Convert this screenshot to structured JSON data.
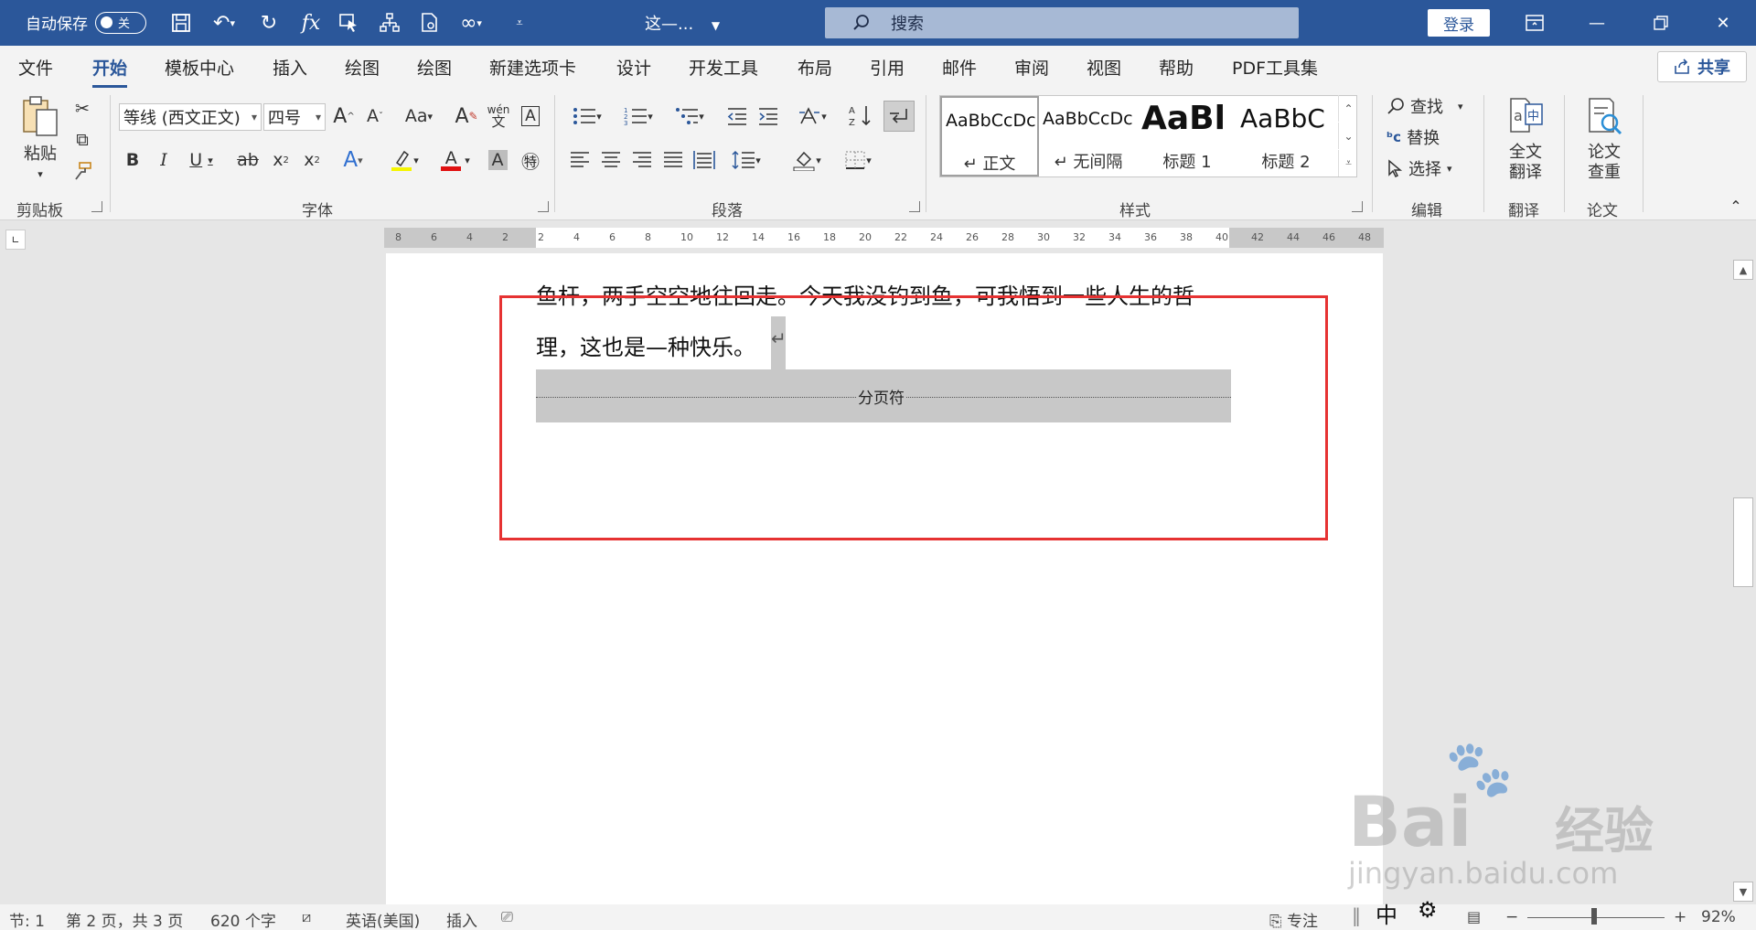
{
  "titlebar": {
    "autosave_label": "自动保存",
    "autosave_state": "关",
    "doc_title": "这—...",
    "search_placeholder": "搜索",
    "login": "登录"
  },
  "tabs": [
    "文件",
    "开始",
    "模板中心",
    "插入",
    "绘图",
    "绘图",
    "新建选项卡",
    "设计",
    "开发工具",
    "布局",
    "引用",
    "邮件",
    "审阅",
    "视图",
    "帮助",
    "PDF工具集"
  ],
  "active_tab": "开始",
  "share_label": "共享",
  "ribbon": {
    "clipboard": {
      "paste": "粘贴",
      "label": "剪贴板"
    },
    "font": {
      "font_name": "等线 (西文正文)",
      "font_size": "四号",
      "label": "字体",
      "phonetic_top": "wén",
      "phonetic_bottom": "文"
    },
    "paragraph": {
      "label": "段落"
    },
    "styles": {
      "label": "样式",
      "items": [
        {
          "sample": "AaBbCcDc",
          "name": "↵ 正文"
        },
        {
          "sample": "AaBbCcDc",
          "name": "↵ 无间隔"
        },
        {
          "sample": "AaBl",
          "name": "标题 1"
        },
        {
          "sample": "AaBbC",
          "name": "标题 2"
        }
      ]
    },
    "editing": {
      "find": "查找",
      "replace": "替换",
      "select": "选择",
      "label": "编辑"
    },
    "translate": {
      "button_line1": "全文",
      "button_line2": "翻译",
      "label": "翻译"
    },
    "paper": {
      "button_line1": "论文",
      "button_line2": "查重",
      "label": "论文"
    }
  },
  "ruler_numbers": [
    "8",
    "6",
    "4",
    "2",
    "2",
    "4",
    "6",
    "8",
    "10",
    "12",
    "14",
    "16",
    "18",
    "20",
    "22",
    "24",
    "26",
    "28",
    "30",
    "32",
    "34",
    "36",
    "38",
    "40",
    "42",
    "44",
    "46",
    "48"
  ],
  "document": {
    "line1": "鱼杆，两手空空地往回走。今天我没钓到鱼，可我悟到一些人生的哲",
    "line2": "理，这也是—种快乐。",
    "paragraph_mark": "↵",
    "page_break_label": "分页符"
  },
  "statusbar": {
    "section": "节: 1",
    "page": "第 2 页，共 3 页",
    "words": "620 个字",
    "language": "英语(美国)",
    "insert_mode": "插入",
    "focus": "专注",
    "ime": "中",
    "zoom_minus": "−",
    "zoom_plus": "+",
    "zoom": "92%"
  },
  "watermark": {
    "brand": "Bai",
    "cn": "经验",
    "url": "jingyan.baidu.com"
  }
}
